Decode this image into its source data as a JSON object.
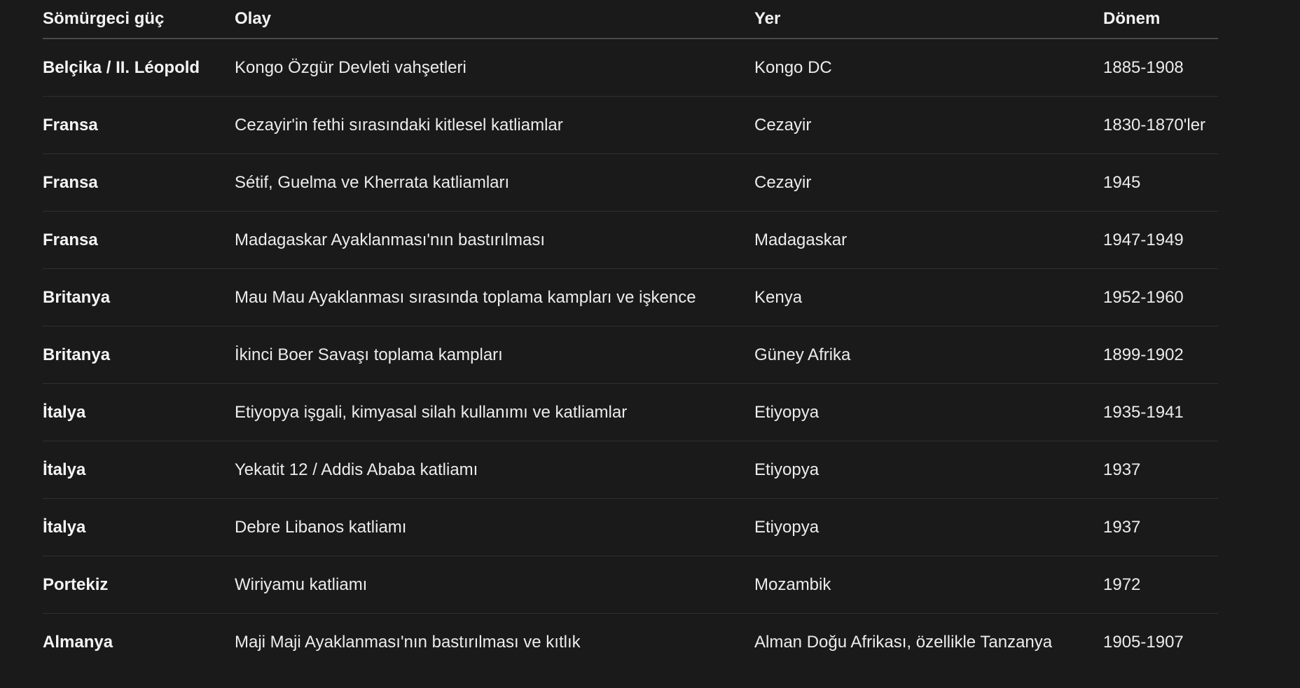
{
  "table": {
    "headers": [
      "Sömürgeci güç",
      "Olay",
      "Yer",
      "Dönem"
    ],
    "rows": [
      [
        "Belçika / II. Léopold",
        "Kongo Özgür Devleti vahşetleri",
        "Kongo DC",
        "1885-1908"
      ],
      [
        "Fransa",
        "Cezayir'in fethi sırasındaki kitlesel katliamlar",
        "Cezayir",
        "1830-1870'ler"
      ],
      [
        "Fransa",
        "Sétif, Guelma ve Kherrata katliamları",
        "Cezayir",
        "1945"
      ],
      [
        "Fransa",
        "Madagaskar Ayaklanması'nın bastırılması",
        "Madagaskar",
        "1947-1949"
      ],
      [
        "Britanya",
        "Mau Mau Ayaklanması sırasında toplama kampları ve işkence",
        "Kenya",
        "1952-1960"
      ],
      [
        "Britanya",
        "İkinci Boer Savaşı toplama kampları",
        "Güney Afrika",
        "1899-1902"
      ],
      [
        "İtalya",
        "Etiyopya işgali, kimyasal silah kullanımı ve katliamlar",
        "Etiyopya",
        "1935-1941"
      ],
      [
        "İtalya",
        "Yekatit 12 / Addis Ababa katliamı",
        "Etiyopya",
        "1937"
      ],
      [
        "İtalya",
        "Debre Libanos katliamı",
        "Etiyopya",
        "1937"
      ],
      [
        "Portekiz",
        "Wiriyamu katliamı",
        "Mozambik",
        "1972"
      ],
      [
        "Almanya",
        "Maji Maji Ayaklanması'nın bastırılması ve kıtlık",
        "Alman Doğu Afrikası, özellikle Tanzanya",
        "1905-1907"
      ]
    ]
  }
}
